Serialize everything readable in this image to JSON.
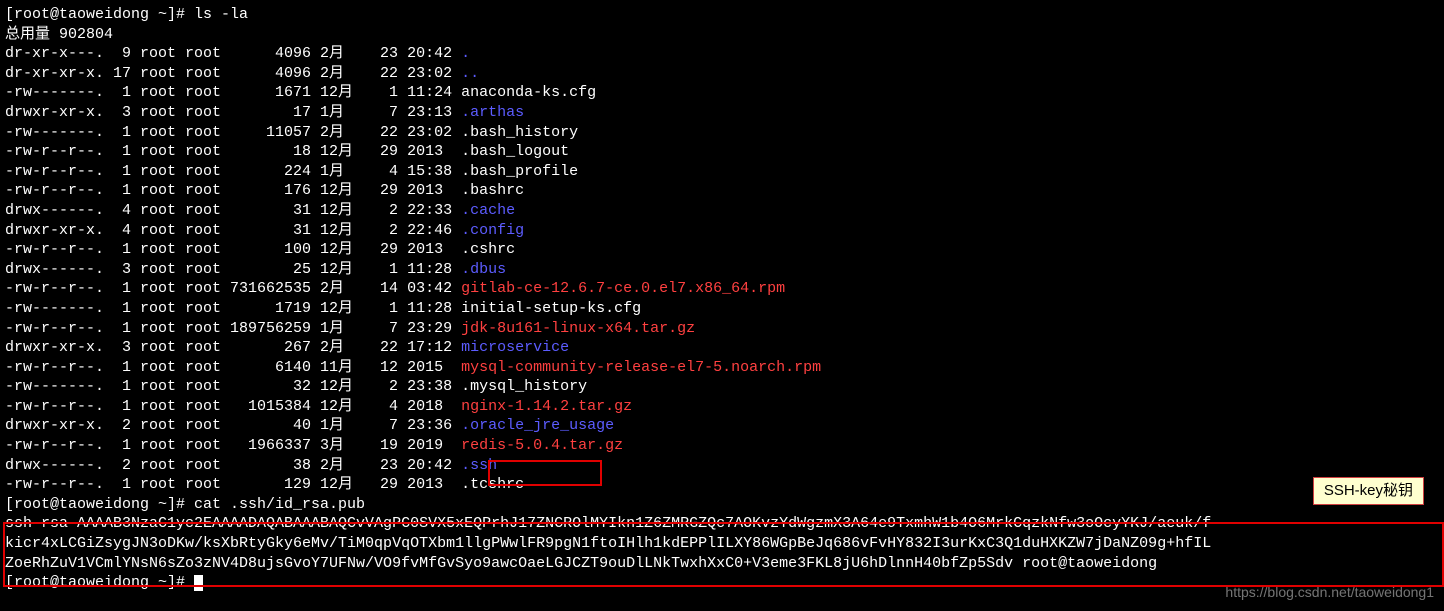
{
  "prompt1": "[root@taoweidong ~]# ",
  "cmd1": "ls -la",
  "total_line": "总用量 902804",
  "listing": [
    {
      "perm": "dr-xr-x---.",
      "links": "9",
      "owner": "root",
      "group": "root",
      "size": "4096",
      "month": "2月",
      "day": "23",
      "time": "20:42",
      "name": ".",
      "color": "blue"
    },
    {
      "perm": "dr-xr-xr-x.",
      "links": "17",
      "owner": "root",
      "group": "root",
      "size": "4096",
      "month": "2月",
      "day": "22",
      "time": "23:02",
      "name": "..",
      "color": "blue"
    },
    {
      "perm": "-rw-------.",
      "links": "1",
      "owner": "root",
      "group": "root",
      "size": "1671",
      "month": "12月",
      "day": "1",
      "time": "11:24",
      "name": "anaconda-ks.cfg",
      "color": "white"
    },
    {
      "perm": "drwxr-xr-x.",
      "links": "3",
      "owner": "root",
      "group": "root",
      "size": "17",
      "month": "1月",
      "day": "7",
      "time": "23:13",
      "name": ".arthas",
      "color": "blue"
    },
    {
      "perm": "-rw-------.",
      "links": "1",
      "owner": "root",
      "group": "root",
      "size": "11057",
      "month": "2月",
      "day": "22",
      "time": "23:02",
      "name": ".bash_history",
      "color": "white"
    },
    {
      "perm": "-rw-r--r--.",
      "links": "1",
      "owner": "root",
      "group": "root",
      "size": "18",
      "month": "12月",
      "day": "29",
      "time": "2013",
      "name": ".bash_logout",
      "color": "white"
    },
    {
      "perm": "-rw-r--r--.",
      "links": "1",
      "owner": "root",
      "group": "root",
      "size": "224",
      "month": "1月",
      "day": "4",
      "time": "15:38",
      "name": ".bash_profile",
      "color": "white"
    },
    {
      "perm": "-rw-r--r--.",
      "links": "1",
      "owner": "root",
      "group": "root",
      "size": "176",
      "month": "12月",
      "day": "29",
      "time": "2013",
      "name": ".bashrc",
      "color": "white"
    },
    {
      "perm": "drwx------.",
      "links": "4",
      "owner": "root",
      "group": "root",
      "size": "31",
      "month": "12月",
      "day": "2",
      "time": "22:33",
      "name": ".cache",
      "color": "blue"
    },
    {
      "perm": "drwxr-xr-x.",
      "links": "4",
      "owner": "root",
      "group": "root",
      "size": "31",
      "month": "12月",
      "day": "2",
      "time": "22:46",
      "name": ".config",
      "color": "blue"
    },
    {
      "perm": "-rw-r--r--.",
      "links": "1",
      "owner": "root",
      "group": "root",
      "size": "100",
      "month": "12月",
      "day": "29",
      "time": "2013",
      "name": ".cshrc",
      "color": "white"
    },
    {
      "perm": "drwx------.",
      "links": "3",
      "owner": "root",
      "group": "root",
      "size": "25",
      "month": "12月",
      "day": "1",
      "time": "11:28",
      "name": ".dbus",
      "color": "blue"
    },
    {
      "perm": "-rw-r--r--.",
      "links": "1",
      "owner": "root",
      "group": "root",
      "size": "731662535",
      "month": "2月",
      "day": "14",
      "time": "03:42",
      "name": "gitlab-ce-12.6.7-ce.0.el7.x86_64.rpm",
      "color": "red"
    },
    {
      "perm": "-rw-------.",
      "links": "1",
      "owner": "root",
      "group": "root",
      "size": "1719",
      "month": "12月",
      "day": "1",
      "time": "11:28",
      "name": "initial-setup-ks.cfg",
      "color": "white"
    },
    {
      "perm": "-rw-r--r--.",
      "links": "1",
      "owner": "root",
      "group": "root",
      "size": "189756259",
      "month": "1月",
      "day": "7",
      "time": "23:29",
      "name": "jdk-8u161-linux-x64.tar.gz",
      "color": "red"
    },
    {
      "perm": "drwxr-xr-x.",
      "links": "3",
      "owner": "root",
      "group": "root",
      "size": "267",
      "month": "2月",
      "day": "22",
      "time": "17:12",
      "name": "microservice",
      "color": "blue"
    },
    {
      "perm": "-rw-r--r--.",
      "links": "1",
      "owner": "root",
      "group": "root",
      "size": "6140",
      "month": "11月",
      "day": "12",
      "time": "2015",
      "name": "mysql-community-release-el7-5.noarch.rpm",
      "color": "red"
    },
    {
      "perm": "-rw-------.",
      "links": "1",
      "owner": "root",
      "group": "root",
      "size": "32",
      "month": "12月",
      "day": "2",
      "time": "23:38",
      "name": ".mysql_history",
      "color": "white"
    },
    {
      "perm": "-rw-r--r--.",
      "links": "1",
      "owner": "root",
      "group": "root",
      "size": "1015384",
      "month": "12月",
      "day": "4",
      "time": "2018",
      "name": "nginx-1.14.2.tar.gz",
      "color": "red"
    },
    {
      "perm": "drwxr-xr-x.",
      "links": "2",
      "owner": "root",
      "group": "root",
      "size": "40",
      "month": "1月",
      "day": "7",
      "time": "23:36",
      "name": ".oracle_jre_usage",
      "color": "blue"
    },
    {
      "perm": "-rw-r--r--.",
      "links": "1",
      "owner": "root",
      "group": "root",
      "size": "1966337",
      "month": "3月",
      "day": "19",
      "time": "2019",
      "name": "redis-5.0.4.tar.gz",
      "color": "red"
    },
    {
      "perm": "drwx------.",
      "links": "2",
      "owner": "root",
      "group": "root",
      "size": "38",
      "month": "2月",
      "day": "23",
      "time": "20:42",
      "name": ".ssh",
      "color": "blue"
    },
    {
      "perm": "-rw-r--r--.",
      "links": "1",
      "owner": "root",
      "group": "root",
      "size": "129",
      "month": "12月",
      "day": "29",
      "time": "2013",
      "name": ".tcshrc",
      "color": "white"
    }
  ],
  "prompt2": "[root@taoweidong ~]# ",
  "cmd2": "cat .ssh/id_rsa.pub",
  "ssh_key_lines": [
    "ssh-rsa AAAAB3NzaC1yc2EAAAADAQABAAABAQCvVAgPC0SVX5xEQPrhJ17ZNCROlMYIkn1Z6ZMRGZQc7AOKvzYdWgzmX3A64e9TxmhW1b4O6MrkCqzkNfw3oOcyYKJ/aeuk/f",
    "kicr4xLCGiZsygJN3oDKw/ksXbRtyGky6eMv/TiM0qpVqOTXbm1llgPWwlFR9pgN1ftoIHlh1kdEPPlILXY86WGpBeJq686vFvHY832I3urKxC3Q1duHXKZW7jDaNZ09g+hfIL",
    "ZoeRhZuV1VCmlYNsN6sZo3zNV4D8ujsGvoY7UFNw/VO9fvMfGvSyo9awcOaeLGJCZT9ouDlLNkTwxhXxC0+V3eme3FKL8jU6hDlnnH40bfZp5Sdv root@taoweidong"
  ],
  "prompt3": "[root@taoweidong ~]# ",
  "callout_label": "SSH-key秘钥",
  "watermark": "https://blog.csdn.net/taoweidong1"
}
